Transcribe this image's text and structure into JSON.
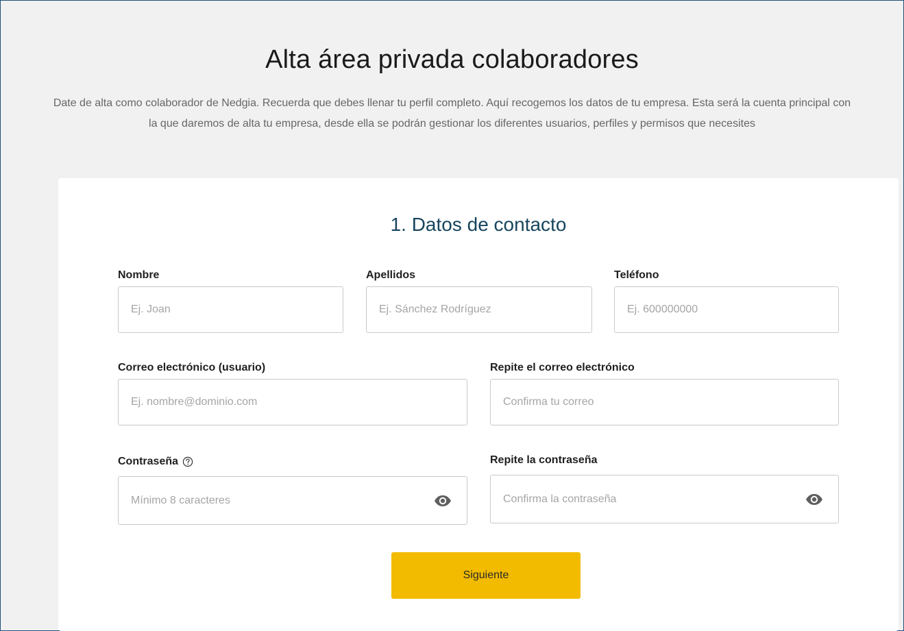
{
  "header": {
    "title": "Alta área privada colaboradores",
    "description": "Date de alta como colaborador de Nedgia. Recuerda que debes llenar tu perfil completo. Aquí recogemos los datos de tu empresa. Esta será la cuenta principal con la que daremos de alta tu empresa, desde ella se podrán gestionar los diferentes usuarios, perfiles y permisos que necesites"
  },
  "form": {
    "section_title": "1. Datos de contacto",
    "fields": {
      "nombre": {
        "label": "Nombre",
        "placeholder": "Ej. Joan",
        "value": ""
      },
      "apellidos": {
        "label": "Apellidos",
        "placeholder": "Ej. Sánchez Rodríguez",
        "value": ""
      },
      "telefono": {
        "label": "Teléfono",
        "placeholder": "Ej. 600000000",
        "value": ""
      },
      "correo": {
        "label": "Correo electrónico (usuario)",
        "placeholder": "Ej. nombre@dominio.com",
        "value": ""
      },
      "correo_repite": {
        "label": "Repite el correo electrónico",
        "placeholder": "Confirma tu correo",
        "value": ""
      },
      "contrasena": {
        "label": "Contraseña",
        "placeholder": "Mínimo 8 caracteres",
        "value": ""
      },
      "contrasena_repite": {
        "label": "Repite la contraseña",
        "placeholder": "Confirma la contraseña",
        "value": ""
      }
    },
    "next_label": "Siguiente"
  },
  "icons": {
    "password_help": "help-circle-icon",
    "show_password": "eye-icon"
  },
  "colors": {
    "background": "#f1f1f1",
    "card": "#ffffff",
    "section_title": "#17455e",
    "accent_button": "#f2bb00",
    "border": "#c9c9c9"
  }
}
